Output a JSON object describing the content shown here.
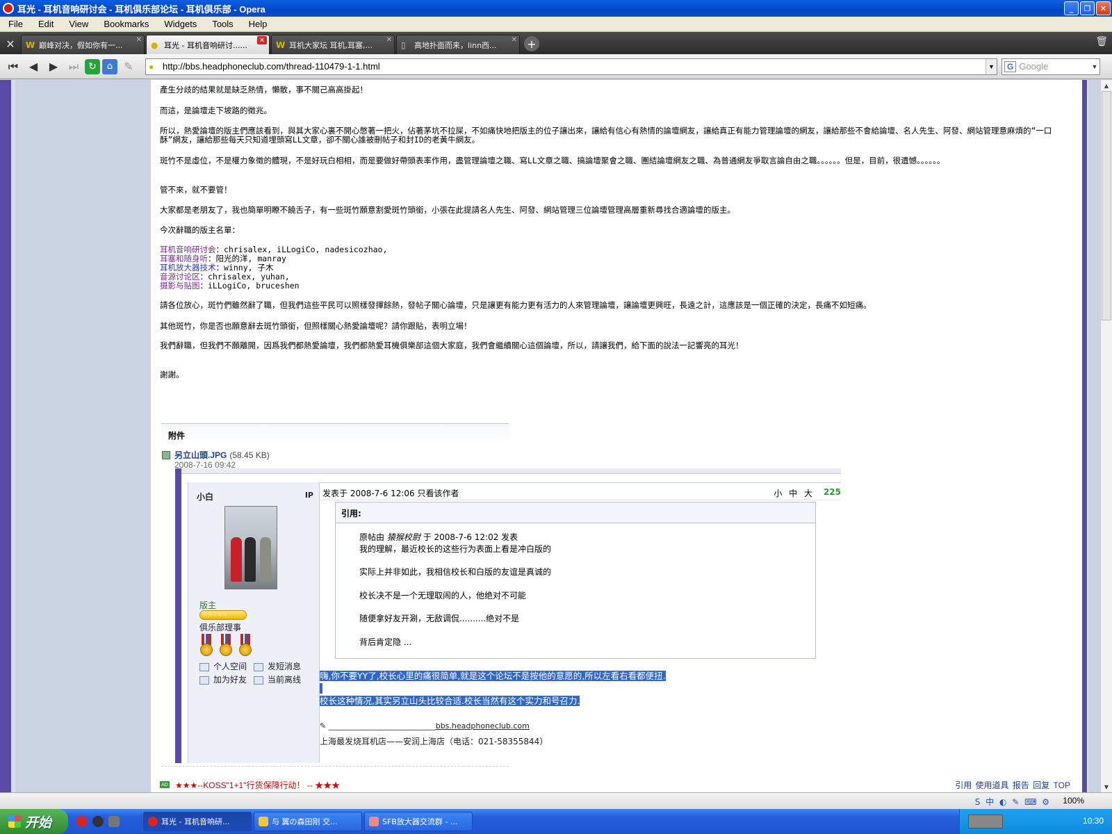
{
  "window": {
    "title": "耳光 - 耳机音响研讨会 - 耳机俱乐部论坛 - 耳机俱乐部 - Opera"
  },
  "menu": [
    "File",
    "Edit",
    "View",
    "Bookmarks",
    "Widgets",
    "Tools",
    "Help"
  ],
  "tabs": [
    {
      "label": "巅峰对决，假如你有一..."
    },
    {
      "label": "耳光 - 耳机音响研讨......"
    },
    {
      "label": "耳机大家坛 耳机,耳塞,..."
    },
    {
      "label": "高地扑面而来，linn西..."
    }
  ],
  "address": {
    "url": "http://bbs.headphoneclub.com/thread-110479-1-1.html",
    "search_placeholder": "Google"
  },
  "post": {
    "lines": [
      "產生分歧的結果就是缺乏熱情，懶散，事不關己高高掛起！",
      "而這，是論壇走下坡路的徵兆。",
      "所以，熱愛論壇的版主們應該看到，與其大家心裏不開心憋著一把火，佔著茅坑不拉屎，不如痛快地把版主的位子讓出來，讓給有信心有熱情的論壇網友，讓給真正有能力管理論壇的網友，讓給那些不會給論壇、名人先生、阿發、網站管理意麻煩的“一口酥”網友，讓給那些每天只知道埋頭寫LL文章，卻不關心誰被刪帖子和封ID的老黃牛網友。",
      "斑竹不是虛位，不是權力象徵的體現，不是好玩白相相，而是要做好帶頭表率作用，盡管理論壇之職、寫LL文章之職、搞論壇聚會之職、團結論壇網友之職、為普通網友爭取言論自由之職。。。。。。但是，目前，很遺憾。。。。。。",
      "管不來，就不要管！",
      "大家都是老朋友了，我也簡單明瞭不饒舌子，有一些斑竹願意割愛斑竹頭銜，小張在此提請名人先生、阿發、網站管理三位論壇管理高層重新尋找合適論壇的版主。",
      "今次辭職的版主名單：",
      "請各位放心，斑竹們雖然辭了職，但我們這些平民可以照樣發揮餘熱，發帖子關心論壇，只是讓更有能力更有活力的人來管理論壇，讓論壇更興旺，長遠之計，這應該是一個正確的決定，長痛不如短痛。",
      "其他斑竹，你是否也願意辭去斑竹頭銜，但照樣關心熱愛論壇呢？請你跟貼，表明立場！",
      "我們辭職，但我們不願離開，因爲我們都熱愛論壇，我們都熱愛耳機俱樂部這個大家庭，我們會繼續關心這個論壇，所以，請讓我們，給下面的說法一記響亮的耳光！",
      "謝謝。"
    ],
    "moderators": [
      {
        "cat": "耳机音响研讨会",
        "names": "：chrisalex, iLLogiCo, nadesicozhao,"
      },
      {
        "cat": "耳塞和随身听",
        "names": "：阳光的洋, manray"
      },
      {
        "cat": "耳机放大器技术",
        "names": "：winny, 子木"
      },
      {
        "cat": "音源讨论区",
        "names": "：chrisalex, yuhan,"
      },
      {
        "cat": "摄影与贴图",
        "names": "：iLLogiCo, bruceshen"
      }
    ]
  },
  "attachment": {
    "heading": "附件",
    "filename": "另立山頭.JPG",
    "size": "(58.45 KB)",
    "date": "2008-7-16 09:42"
  },
  "embedded": {
    "username": "小白",
    "ip": "IP",
    "rank": "版主",
    "stars": "☆☆☆☆☆",
    "title": "俱乐部理事",
    "links": [
      "个人空间",
      "加为好友",
      "发短消息",
      "当前离线"
    ],
    "meta": "发表于 2008-7-6 12:06 只看该作者",
    "size_ctl": "小 中 大",
    "floor": "225",
    "quote_head": "引用:",
    "quote_author_prefix": "原帖由",
    "quote_author": "猿猴校尉",
    "quote_author_suffix": "于 2008-7-6 12:02 发表",
    "quote_lines": [
      "我的理解，最近校长的这些行为表面上看是冲白版的",
      "实际上并非如此，我相信校长和白版的友谊是真诚的",
      "校长决不是一个无理取闹的人，他绝对不可能",
      "随便拿好友开涮，无敌调侃..........绝对不是",
      "背后肯定隐 ..."
    ],
    "selected_lines": [
      "嗨,你不要YY了,校长心里的痛很简单,就是这个论坛不是按他的意愿的,所以左看右看都便扭.",
      " ",
      "校长这种情况,其实另立山头比较合适.校长当然有这个实力和号召力."
    ],
    "signature_link": "bbs.headphoneclub.com",
    "signature_shop": "上海最发烧耳机店——安润上海店（电话：021-58355844）"
  },
  "footer": {
    "ad_badge": "AD",
    "ad_text": "★★★--KOSS\"1+1\"行货保障行动！ -- ★★★",
    "actions": "引用 使用道具 报告 回复 TOP"
  },
  "statusbar": {
    "zoom": "100%"
  },
  "taskbar": {
    "start": "开始",
    "buttons": [
      "耳光 - 耳机音响研...",
      "与  翼の森田刚 交...",
      "SFB放大器交流群 - ..."
    ],
    "clock": "10:30"
  }
}
